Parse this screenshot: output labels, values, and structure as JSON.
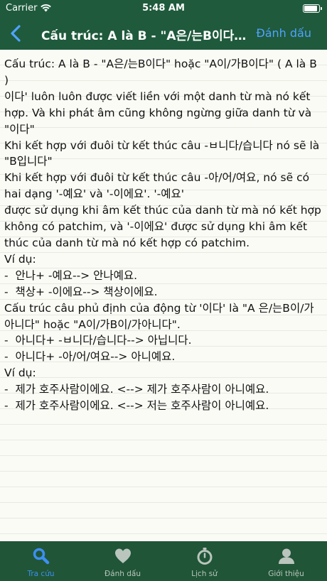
{
  "status_bar": {
    "carrier": "Carrier",
    "time": "5:48 AM"
  },
  "nav": {
    "back_icon": "chevron-left-icon",
    "title": "Cấu trúc: A là B - \"A은/는B이다\" hoặc \"A이/가B이다\" ( A là B )",
    "bookmark_label": "Đánh dấu"
  },
  "content": {
    "body": "Cấu trúc: A là B - \"A은/는B이다\" hoặc \"A이/가B이다\" ( A là B )\n이다' luôn luôn được viết liền với một danh từ mà nó kết hợp. Và khi phát âm cũng không ngừng giữa danh từ và \"이다\"\nKhi kết hợp với đuôi từ kết thúc câu -ㅂ니다/습니다 nó sẽ là \"B입니다\"\nKhi kết hợp với đuôi từ kết thúc câu -아/어/여요, nó sẽ có hai dạng '-예요' và '-이에요'. '-예요'\nđược sử dụng khi âm kết thúc của danh từ mà nó kết hợp không có patchim, và '-이에요' được sử dụng khi âm kết thúc của danh từ mà nó kết hợp có patchim.\nVí dụ:\n-  안나+ -예요--> 안나예요.\n-  책상+ -이에요--> 책상이에요.\nCấu trúc câu phủ định của động từ '이다' là \"A 은/는B이/가 아니다\" hoặc \"A이/가B이/가아니다\".\n-  아니다+ -ㅂ니다/습니다--> 아닙니다.\n-  아니다+ -아/어/여요--> 아니예요.\nVí dụ:\n-  제가 호주사람이에요. <--> 제가 호주사람이 아니예요.\n-  제가 호주사람이에요. <--> 저는 호주사람이 아니예요."
  },
  "tabs": [
    {
      "label": "Tra cứu",
      "icon": "search-icon",
      "active": true
    },
    {
      "label": "Đánh dấu",
      "icon": "heart-icon",
      "active": false
    },
    {
      "label": "Lịch sử",
      "icon": "stopwatch-icon",
      "active": false
    },
    {
      "label": "Giới thiệu",
      "icon": "person-icon",
      "active": false
    }
  ],
  "colors": {
    "bar": "#1f5a3c",
    "accent": "#3d8ff0",
    "paper": "#fbfbf6"
  }
}
